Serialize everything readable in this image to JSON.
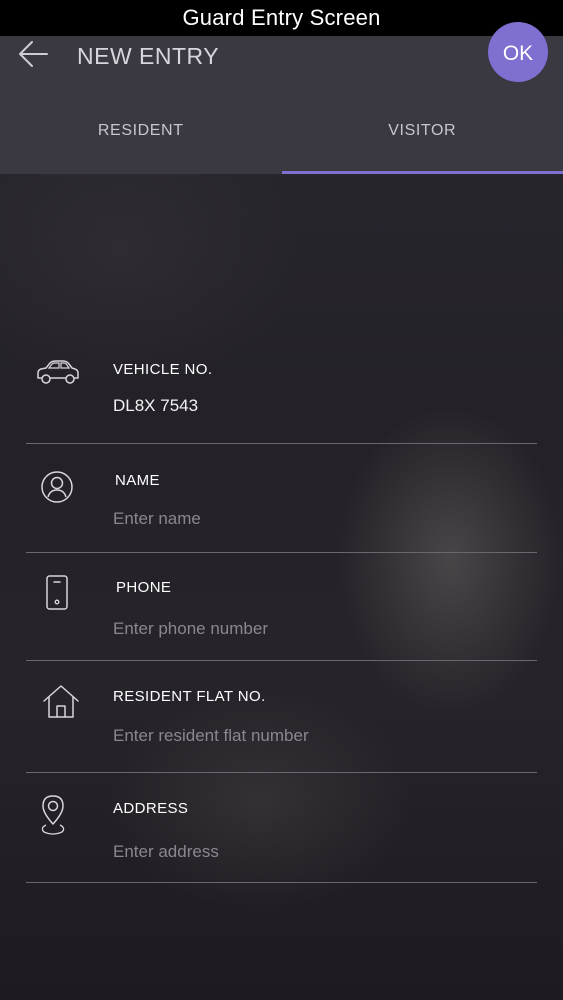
{
  "window": {
    "title": "Guard Entry Screen"
  },
  "app_bar": {
    "title": "NEW ENTRY",
    "ok_label": "OK",
    "accent_color": "#7e6fd1"
  },
  "tabs": [
    {
      "label": "RESIDENT",
      "active": false
    },
    {
      "label": "VISITOR",
      "active": true
    }
  ],
  "fields": {
    "vehicle": {
      "label": "VEHICLE NO.",
      "value": "DL8X 7543",
      "placeholder": "",
      "icon": "car-icon"
    },
    "name": {
      "label": "NAME",
      "value": "",
      "placeholder": "Enter name",
      "icon": "user-circle-icon"
    },
    "phone": {
      "label": "PHONE",
      "value": "",
      "placeholder": "Enter phone number",
      "icon": "phone-icon"
    },
    "flat": {
      "label": "RESIDENT FLAT NO.",
      "value": "",
      "placeholder": "Enter resident flat number",
      "icon": "home-icon"
    },
    "address": {
      "label": "ADDRESS",
      "value": "",
      "placeholder": "Enter address",
      "icon": "location-pin-icon"
    }
  }
}
